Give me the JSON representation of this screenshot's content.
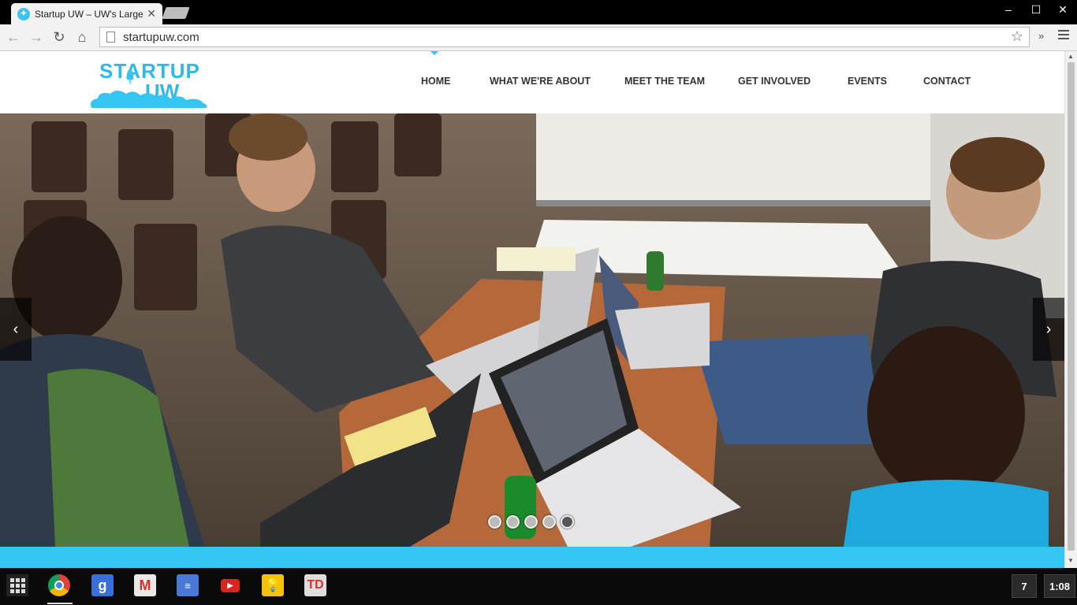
{
  "browser": {
    "tab_title": "Startup UW – UW's Largest",
    "tab_close": "✕",
    "url": "startupuw.com",
    "controls": {
      "minimize": "–",
      "maximize": "☐",
      "close": "✕"
    },
    "nav": {
      "back": "←",
      "forward": "→",
      "reload": "↻",
      "home": "⌂",
      "star": "☆",
      "extensions": "»"
    }
  },
  "site": {
    "logo_line1": "STARTUP",
    "logo_line2": "UW",
    "brand_color": "#35c5f2",
    "nav": [
      "HOME",
      "WHAT WE'RE ABOUT",
      "MEET THE TEAM",
      "GET INVOLVED",
      "EVENTS",
      "CONTACT"
    ],
    "active_nav": "HOME",
    "slider": {
      "prev": "‹",
      "next": "›",
      "slide_count": 5,
      "active_slide": 5
    },
    "hero_alt": "Students working on laptops around a table"
  },
  "taskbar": {
    "apps": [
      "chrome-icon",
      "google-search-icon",
      "gmail-icon",
      "docs-icon",
      "youtube-icon",
      "keep-icon",
      "todoist-icon"
    ],
    "notification_count": "7",
    "clock": "1:08"
  }
}
